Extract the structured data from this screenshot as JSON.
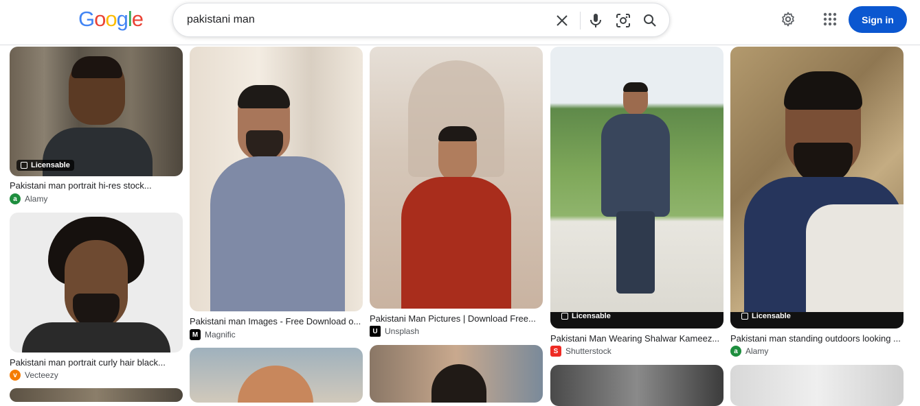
{
  "header": {
    "logo_letters": [
      "G",
      "o",
      "o",
      "g",
      "l",
      "e"
    ],
    "logo_colors": [
      "#4285f4",
      "#ea4335",
      "#fbbc05",
      "#4285f4",
      "#34a853",
      "#ea4335"
    ],
    "search_value": "pakistani man",
    "signin_label": "Sign in",
    "icons": [
      "close-icon",
      "microphone-icon",
      "lens-icon",
      "search-icon",
      "settings-gear-icon",
      "apps-grid-icon"
    ]
  },
  "results": [
    {
      "caption": "Pakistani man portrait hi-res stock...",
      "source": "Alamy",
      "badge": "Licensable",
      "favicon": "a",
      "favicon_color": "#1e8e3e"
    },
    {
      "caption": "Pakistani man portrait curly hair black...",
      "source": "Vecteezy",
      "favicon": "v",
      "favicon_color": "#f57c00"
    },
    {
      "caption": "Pakistani man Images - Free Download o...",
      "source": "Magnific",
      "favicon": "M",
      "favicon_color": "#000000"
    },
    {
      "caption": "Pakistani Man Pictures | Download Free...",
      "source": "Unsplash",
      "favicon": "U",
      "favicon_color": "#000000"
    },
    {
      "caption": "Pakistani Man Wearing Shalwar Kameez...",
      "source": "Shutterstock",
      "badge": "Licensable",
      "favicon": "S",
      "favicon_color": "#ee2b24"
    },
    {
      "caption": "Pakistani man standing outdoors looking ...",
      "source": "Alamy",
      "badge": "Licensable",
      "favicon": "a",
      "favicon_color": "#1e8e3e"
    }
  ]
}
